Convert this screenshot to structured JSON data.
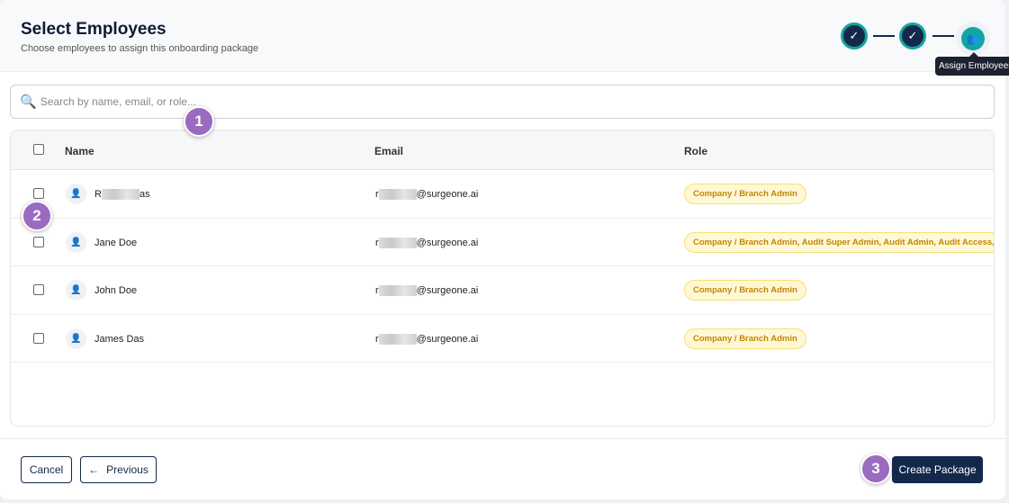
{
  "header": {
    "title": "Select Employees",
    "subtitle": "Choose employees to assign this onboarding package"
  },
  "stepper": {
    "steps": [
      {
        "icon": "check-icon",
        "state": "complete"
      },
      {
        "icon": "check-icon",
        "state": "complete"
      },
      {
        "icon": "users-icon",
        "state": "active",
        "tooltip": "Assign Employees"
      }
    ],
    "accent": "#12a6a0"
  },
  "search": {
    "placeholder": "Search by name, email, or role...",
    "value": ""
  },
  "table": {
    "columns": [
      "Name",
      "Email",
      "Role"
    ],
    "rows": [
      {
        "name_start": "R",
        "name_end": "as",
        "email_start": "r",
        "email_end": "@surgeone.ai",
        "role": "Company / Branch Admin"
      },
      {
        "name_start": "Jane Doe",
        "name_end": "",
        "email_start": "r",
        "email_end": "@surgeone.ai",
        "role": "Company / Branch Admin, Audit Super Admin, Audit Admin, Audit Access,..."
      },
      {
        "name_start": "John Doe",
        "name_end": "",
        "email_start": "r",
        "email_end": "@surgeone.ai",
        "role": "Company / Branch Admin"
      },
      {
        "name_start": "James Das",
        "name_end": "",
        "email_start": "r",
        "email_end": "@surgeone.ai",
        "role": "Company / Branch Admin"
      }
    ]
  },
  "footer": {
    "cancel": "Cancel",
    "previous": "Previous",
    "previous_icon": "arrow-left-icon",
    "create": "Create Package"
  },
  "markers": [
    "1",
    "2",
    "3"
  ]
}
